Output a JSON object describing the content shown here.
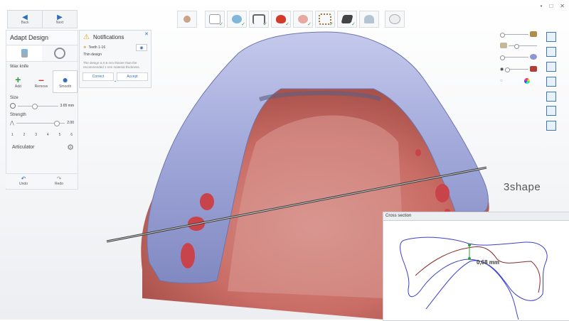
{
  "window": {
    "minimize": "•",
    "maximize": "□",
    "close": "✕"
  },
  "nav": {
    "back_label": "Back",
    "next_label": "Next"
  },
  "toolbar": {
    "steps": [
      "patient",
      "scan-prep",
      "scan",
      "margin",
      "design-1",
      "design-2",
      "design-3",
      "design-4",
      "design-5",
      "design-6",
      "export"
    ]
  },
  "panel": {
    "title": "Adapt Design",
    "tool_label": "Wax knife",
    "actions": {
      "add": "Add",
      "remove": "Remove",
      "smooth": "Smooth"
    },
    "size_label": "Size",
    "size_value": "3.65 mm",
    "size_level": 0.35,
    "strength_label": "Strength",
    "strength_value": "2.00",
    "strength_level": 0.78,
    "steps": [
      "1",
      "2",
      "3",
      "4",
      "5",
      "6"
    ],
    "articulator_label": "Articulator",
    "undo_label": "Undo",
    "redo_label": "Redo"
  },
  "notification": {
    "title": "Notifications",
    "teeth": "Teeth 1-16",
    "type": "Thin design",
    "description": "The design is 0.5 mm thinner than the recommended 1 mm material thickness.",
    "correct_label": "Correct",
    "accept_label": "Accept"
  },
  "cross_section": {
    "title": "Cross section",
    "measurement": "0,68 mm"
  },
  "logo": "3shape"
}
